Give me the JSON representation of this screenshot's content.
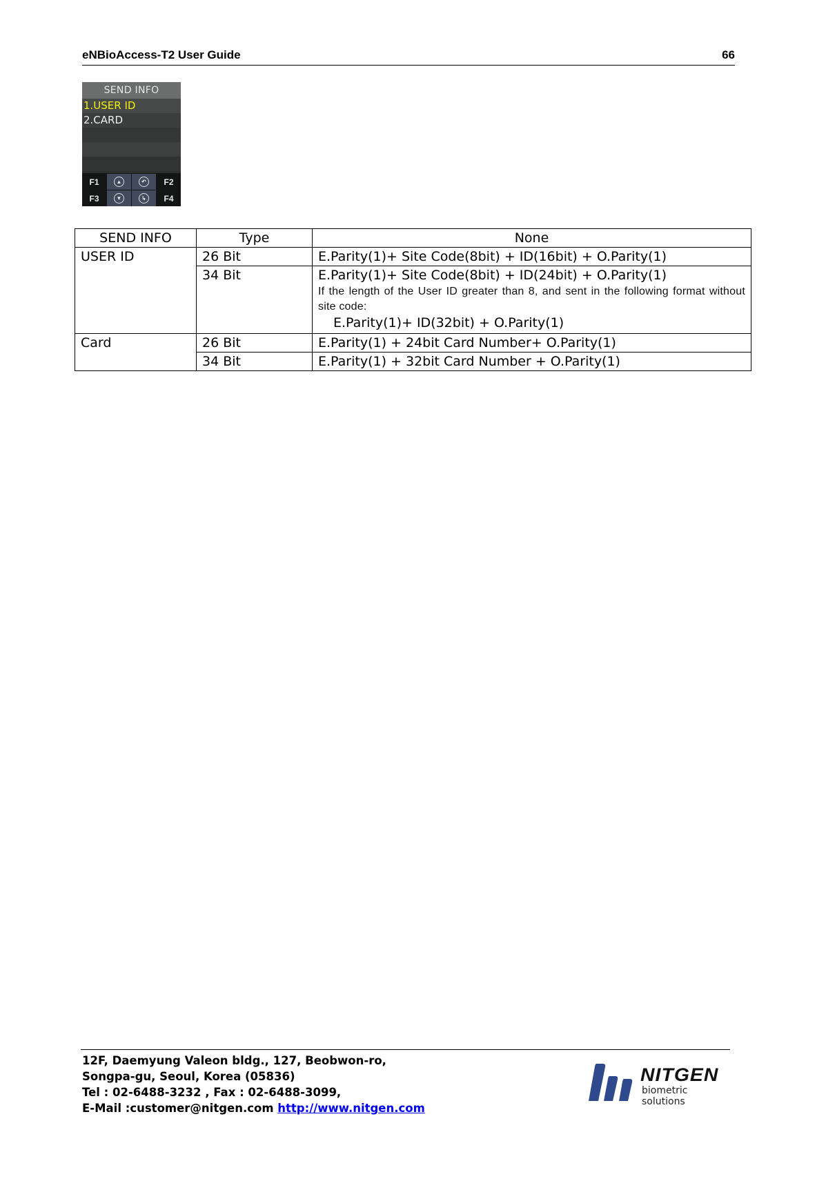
{
  "header": {
    "title": "eNBioAccess-T2 User Guide",
    "page_number": "66"
  },
  "device_screen": {
    "title": "SEND INFO",
    "menu_items": [
      {
        "label": "1.USER ID",
        "selected": true
      },
      {
        "label": "2.CARD",
        "selected": false
      }
    ],
    "keys": {
      "f1": "F1",
      "f2": "F2",
      "f3": "F3",
      "f4": "F4",
      "up_icon": "up-arrow-icon",
      "down_icon": "down-arrow-icon",
      "back_icon": "back-arrow-icon",
      "enter_icon": "enter-arrow-icon"
    },
    "colors": {
      "title_bg": "#6b6e6c",
      "selected_text": "#f5f20a",
      "nav_key_bg": "#434a5c"
    }
  },
  "table": {
    "headers": [
      "SEND INFO",
      "Type",
      "None"
    ],
    "groups": [
      {
        "name": "USER ID",
        "rows": [
          {
            "type": "26 Bit",
            "format": "E.Parity(1)+ Site Code(8bit) + ID(16bit) + O.Parity(1)"
          },
          {
            "type": "34 Bit",
            "format": "E.Parity(1)+ Site Code(8bit) + ID(24bit) + O.Parity(1)",
            "note": "If the length of the User ID greater than 8, and sent in the following format without site code:",
            "alt_format": "E.Parity(1)+ ID(32bit) + O.Parity(1)"
          }
        ]
      },
      {
        "name": "Card",
        "rows": [
          {
            "type": "26 Bit",
            "format": "E.Parity(1) + 24bit Card Number+ O.Parity(1)"
          },
          {
            "type": "34 Bit",
            "format": "E.Parity(1) + 32bit Card Number + O.Parity(1)"
          }
        ]
      }
    ]
  },
  "footer": {
    "address_line1": "12F, Daemyung Valeon bldg., 127, Beobwon-ro,",
    "address_line2": "Songpa-gu, Seoul, Korea (05836)",
    "contact_line": "Tel : 02-6488-3232 , Fax : 02-6488-3099,",
    "email_prefix": "E-Mail :customer@nitgen.com ",
    "website": "http://www.nitgen.com",
    "logo": {
      "brand": "NITGEN",
      "tagline": "biometric solutions",
      "color": "#2f4a8c"
    }
  }
}
